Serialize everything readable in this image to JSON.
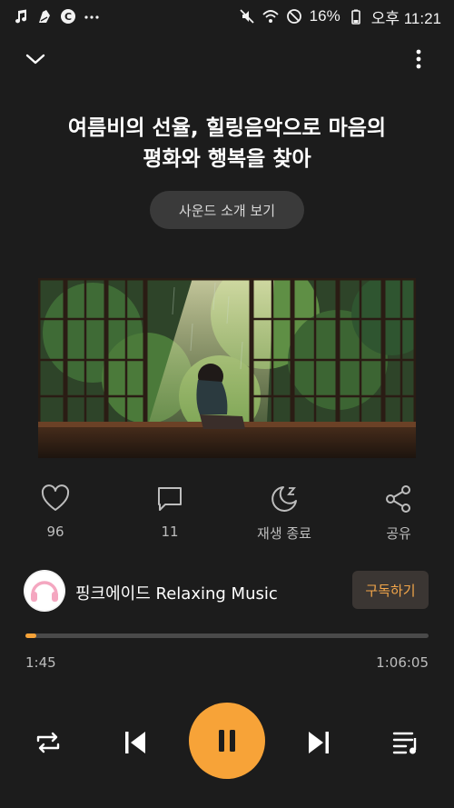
{
  "status_bar": {
    "left_icons": [
      "music-note-icon",
      "piano-icon",
      "c-badge-icon",
      "more-dots-icon"
    ],
    "battery": "16%",
    "time": "오후 11:21"
  },
  "track": {
    "title": "여름비의 선율, 힐링음악으로 마음의\n평화와 행복을 찾아",
    "sound_intro_button": "사운드 소개 보기"
  },
  "actions": [
    {
      "icon": "heart-icon",
      "label": "96"
    },
    {
      "icon": "comment-icon",
      "label": "11"
    },
    {
      "icon": "sleep-timer-icon",
      "label": "재생 종료"
    },
    {
      "icon": "share-icon",
      "label": "공유"
    }
  ],
  "channel": {
    "name": "핑크에이드 Relaxing Music",
    "subscribe_label": "구독하기"
  },
  "player": {
    "current_time": "1:45",
    "total_time": "1:06:05",
    "progress": 0.026
  },
  "colors": {
    "background": "#1c1c1c",
    "accent": "#f7a338",
    "subscribe_bg": "#3b3633"
  }
}
